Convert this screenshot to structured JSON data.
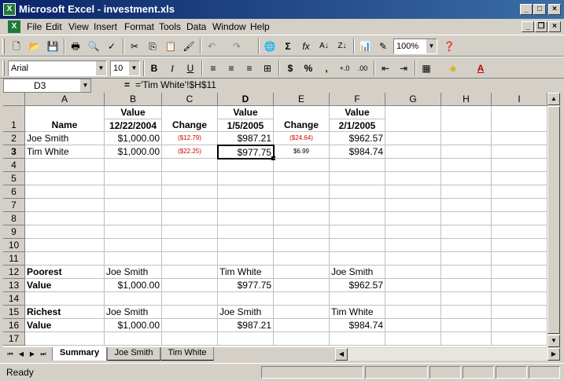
{
  "window": {
    "title": "Microsoft Excel - investment.xls"
  },
  "menu": [
    "File",
    "Edit",
    "View",
    "Insert",
    "Format",
    "Tools",
    "Data",
    "Window",
    "Help"
  ],
  "toolbar": {
    "zoom": "100%",
    "font": "Arial",
    "size": "10",
    "bold": "B",
    "italic": "I",
    "underline": "U",
    "currency": "$",
    "percent": "%",
    "comma": ",",
    "inc_dec": "+.0",
    "dec_dec": ".00"
  },
  "formula_bar": {
    "name_box": "D3",
    "equals": "=",
    "formula": "='Tim White'!$H$11"
  },
  "columns": [
    "A",
    "B",
    "C",
    "D",
    "E",
    "F",
    "G",
    "H",
    "I"
  ],
  "rows": [
    "1",
    "2",
    "3",
    "4",
    "5",
    "6",
    "7",
    "8",
    "9",
    "10",
    "11",
    "12",
    "13",
    "14",
    "15",
    "16",
    "17"
  ],
  "cells": {
    "A1": "Name",
    "B1a": "Value",
    "B1b": "12/22/2004",
    "C1": "Change",
    "D1a": "Value",
    "D1b": "1/5/2005",
    "E1": "Change",
    "F1a": "Value",
    "F1b": "2/1/2005",
    "A2": "Joe Smith",
    "B2": "$1,000.00",
    "C2": "($12.79)",
    "D2": "$987.21",
    "E2": "($24.64)",
    "F2": "$962.57",
    "A3": "Tim White",
    "B3": "$1,000.00",
    "C3": "($22.25)",
    "D3": "$977.75",
    "E3": "$6.99",
    "F3": "$984.74",
    "A12": "Poorest",
    "B12": "Joe Smith",
    "D12": "Tim White",
    "F12": "Joe Smith",
    "A13": "Value",
    "B13": "$1,000.00",
    "D13": "$977.75",
    "F13": "$962.57",
    "A15": "Richest",
    "B15": "Joe Smith",
    "D15": "Joe Smith",
    "F15": "Tim White",
    "A16": "Value",
    "B16": "$1,000.00",
    "D16": "$987.21",
    "F16": "$984.74"
  },
  "sheets": [
    "Summary",
    "Joe Smith",
    "Tim White"
  ],
  "status": "Ready"
}
